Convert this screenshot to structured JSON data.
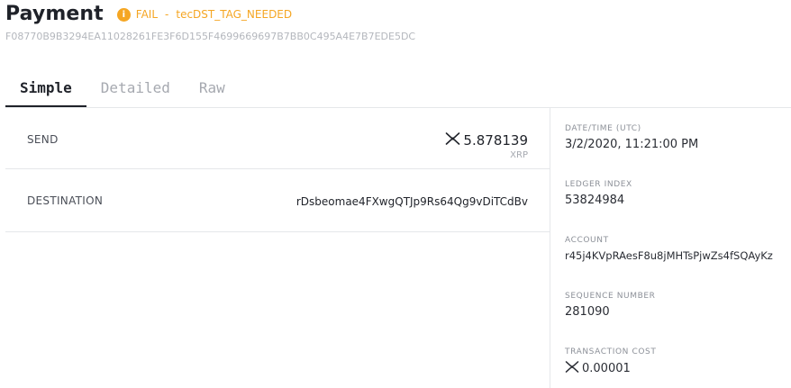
{
  "header": {
    "title": "Payment",
    "status_icon": "info-icon",
    "status_label": "FAIL",
    "status_separator": "-",
    "status_code": "tecDST_TAG_NEEDED",
    "status_color": "#f5a623",
    "hash": "F08770B9B3294EA11028261FE3F6D155F4699669697B7BB0C495A4E7B7EDE5DC"
  },
  "tabs": [
    {
      "label": "Simple",
      "active": true
    },
    {
      "label": "Detailed",
      "active": false
    },
    {
      "label": "Raw",
      "active": false
    }
  ],
  "simple": {
    "send": {
      "label": "SEND",
      "amount": "5.878139",
      "currency": "XRP",
      "icon": "xrp-icon"
    },
    "destination": {
      "label": "DESTINATION",
      "value": "rDsbeomae4FXwgQTJp9Rs64Qg9vDiTCdBv"
    }
  },
  "details": {
    "datetime": {
      "label": "DATE/TIME  (UTC)",
      "value": "3/2/2020,  11:21:00  PM"
    },
    "ledger_index": {
      "label": "LEDGER  INDEX",
      "value": "53824984"
    },
    "account": {
      "label": "ACCOUNT",
      "value": "r45j4KVpRAesF8u8jMHTsPjwZs4fSQAyKz"
    },
    "sequence_number": {
      "label": "SEQUENCE  NUMBER",
      "value": "281090"
    },
    "transaction_cost": {
      "label": "TRANSACTION  COST",
      "value": "0.00001",
      "icon": "xrp-icon"
    }
  }
}
